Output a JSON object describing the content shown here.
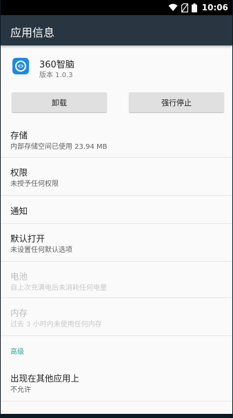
{
  "status_bar": {
    "time": "10:06",
    "icons": [
      "wifi-icon",
      "no-sim-icon",
      "battery-icon"
    ]
  },
  "app_bar": {
    "title": "应用信息"
  },
  "app": {
    "name": "360智脑",
    "version": "版本 1.0.3",
    "icon": "360-brain-app-icon",
    "icon_color": "#1e88e5"
  },
  "buttons": {
    "uninstall": "卸载",
    "force_stop": "强行停止"
  },
  "items": {
    "storage": {
      "title": "存储",
      "subtitle": "内部存储空间已使用 23.94 MB"
    },
    "permissions": {
      "title": "权限",
      "subtitle": "未授予任何权限"
    },
    "notifications": {
      "title": "通知"
    },
    "open_by_default": {
      "title": "默认打开",
      "subtitle": "未设置任何默认选项"
    },
    "battery": {
      "title": "电池",
      "subtitle": "自上次充满电后未消耗任何电量"
    },
    "memory": {
      "title": "内存",
      "subtitle": "过去 3 小时内未使用任何内存"
    },
    "advanced_label": "高级",
    "draw_over_apps": {
      "title": "出现在其他应用上",
      "subtitle": "不允许"
    }
  },
  "colors": {
    "app_bar": "#273640",
    "accent": "#26a69a",
    "background": "#fafafa"
  }
}
